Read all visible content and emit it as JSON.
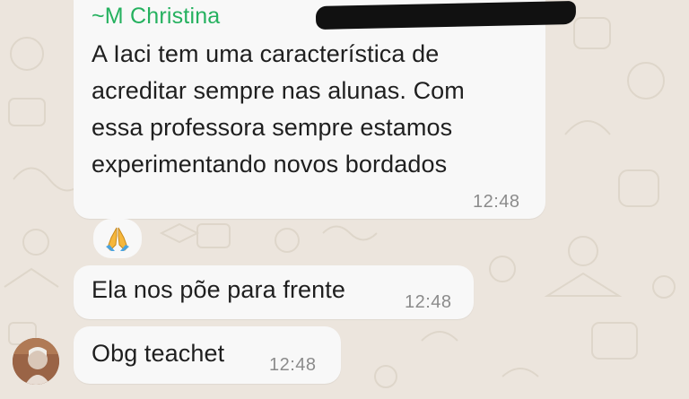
{
  "messages": [
    {
      "sender": "~M Christina",
      "lines": [
        "A Iaci tem uma característica de",
        "acreditar sempre nas alunas. Com",
        "essa professora sempre estamos",
        "experimentando novos bordados"
      ],
      "time": "12:48",
      "reaction": "pray-emoji"
    },
    {
      "text": "Ela nos põe para frente",
      "time": "12:48"
    },
    {
      "text": "Obg teachet",
      "time": "12:48"
    }
  ],
  "colors": {
    "background": "#ece5dd",
    "bubble": "#f8f8f8",
    "sender_name": "#25b15f",
    "message_text": "#1f1f1f",
    "timestamp": "#8b8b8b"
  }
}
